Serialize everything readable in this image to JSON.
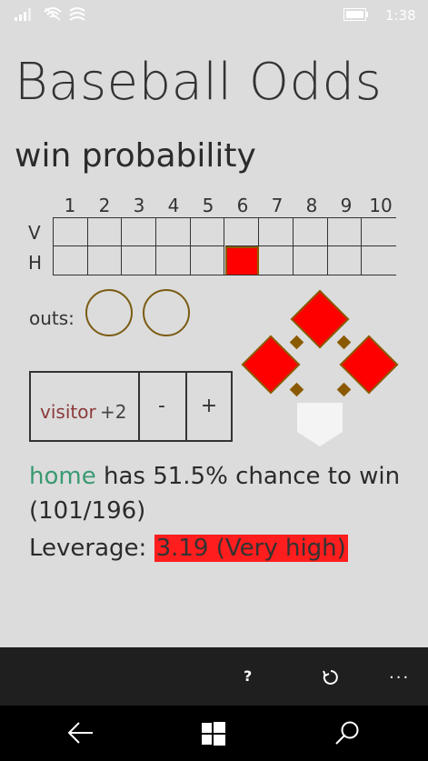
{
  "status_bar": {
    "time": "1:38"
  },
  "app_title": "Baseball Odds",
  "page_title": "win probability",
  "innings": [
    "1",
    "2",
    "3",
    "4",
    "5",
    "6",
    "7",
    "8",
    "9",
    "10"
  ],
  "row_labels": {
    "visitor": "V",
    "home": "H"
  },
  "current_inning": {
    "row": "H",
    "inning": 6
  },
  "outs": {
    "label": "outs:",
    "count": 0,
    "max": 2
  },
  "bases": {
    "first": true,
    "second": true,
    "third": true
  },
  "score_control": {
    "team": "visitor",
    "margin": "+2",
    "minus_label": "-",
    "plus_label": "+"
  },
  "result": {
    "team": "home",
    "text": " has 51.5% chance to win",
    "ratio": "(101/196)",
    "leverage_label": "Leverage: ",
    "leverage_value": "3.19 (Very high)"
  },
  "colors": {
    "accent_red": "#ff0000",
    "home_green": "#3a9a72",
    "visitor_maroon": "#8b3a3a",
    "base_brown": "#8b5a00"
  },
  "app_bar": {
    "help_label": "?",
    "more_label": "..."
  }
}
